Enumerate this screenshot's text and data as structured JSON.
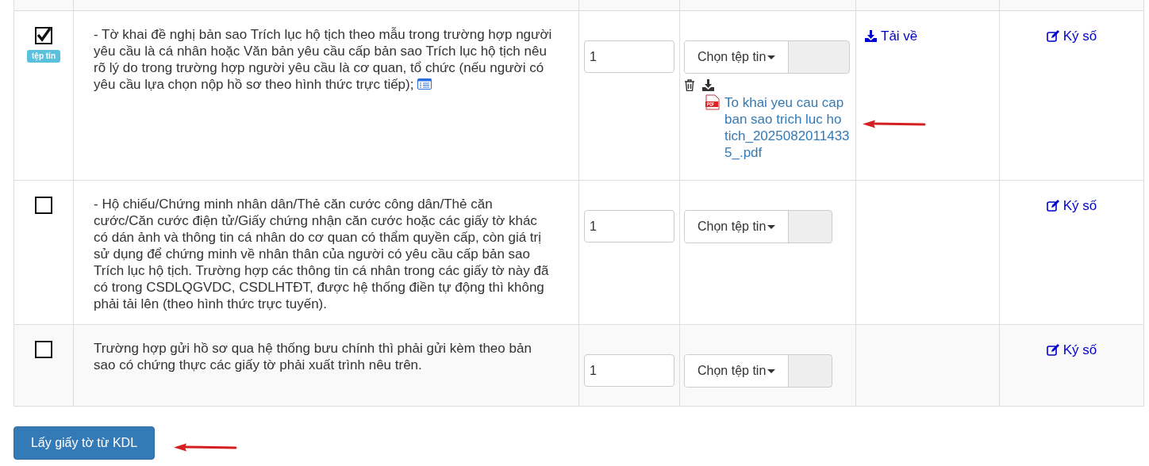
{
  "rows": [
    {
      "checked": true,
      "badge": "tệp tin",
      "description": "- Tờ khai đề nghị bản sao Trích lục hộ tịch theo mẫu trong trường hợp người yêu cầu là cá nhân hoặc Văn bản yêu cầu cấp bản sao Trích lục hộ tịch nêu rõ lý do trong trường hợp người yêu cầu là cơ quan, tổ chức (nếu người có yêu cầu lựa chọn nộp hồ sơ theo hình thức trực tiếp);",
      "detail_icon": true,
      "quantity": "1",
      "file_button": "Chọn tệp tin",
      "files": [
        {
          "name": "To khai yeu cau cap ban sao trich luc ho tich_20250820114335_.pdf"
        }
      ],
      "download": "Tải về",
      "sign": "Ký số"
    },
    {
      "checked": false,
      "description": "- Hộ chiếu/Chứng minh nhân dân/Thẻ căn cước công dân/Thẻ căn cước/Căn cước điện tử/Giấy chứng nhận căn cước hoặc các giấy tờ khác có dán ảnh và thông tin cá nhân do cơ quan có thẩm quyền cấp, còn giá trị sử dụng để chứng minh về nhân thân của người có yêu cầu cấp bản sao Trích lục hộ tịch. Trường hợp các thông tin cá nhân trong các giấy tờ này đã có trong CSDLQGVDC, CSDLHTĐT, được hệ thống điền tự động thì không phải tải lên (theo hình thức trực tuyến).",
      "detail_icon": false,
      "quantity": "1",
      "file_button": "Chọn tệp tin",
      "sign": "Ký số"
    },
    {
      "checked": false,
      "description": "Trường hợp gửi hồ sơ qua hệ thống bưu chính thì phải gửi kèm theo bản sao có chứng thực các giấy tờ phải xuất trình nêu trên.",
      "detail_icon": false,
      "quantity": "1",
      "file_button": "Chọn tệp tin",
      "sign": "Ký số"
    }
  ],
  "action_button": "Lấy giấy tờ từ KDL"
}
